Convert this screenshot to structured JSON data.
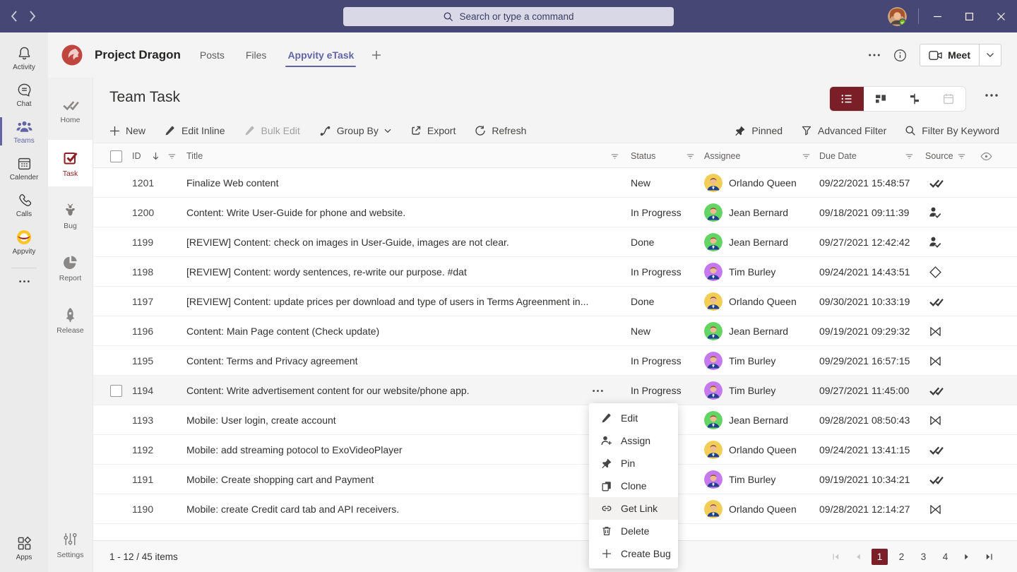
{
  "titlebar": {
    "search_placeholder": "Search or type a command"
  },
  "team_header": {
    "team_name": "Project Dragon",
    "tabs": [
      {
        "label": "Posts"
      },
      {
        "label": "Files"
      },
      {
        "label": "Appvity eTask",
        "active": true
      }
    ],
    "meet_label": "Meet"
  },
  "left_rail": {
    "items": [
      {
        "label": "Activity"
      },
      {
        "label": "Chat"
      },
      {
        "label": "Teams",
        "active": true
      },
      {
        "label": "Calender"
      },
      {
        "label": "Calls"
      },
      {
        "label": "Appvity"
      }
    ],
    "apps_label": "Apps"
  },
  "app_rail": {
    "items": [
      {
        "label": "Home"
      },
      {
        "label": "Task",
        "active": true
      },
      {
        "label": "Bug"
      },
      {
        "label": "Report"
      },
      {
        "label": "Release"
      }
    ],
    "settings_label": "Settings"
  },
  "page": {
    "title": "Team Task"
  },
  "toolbar": {
    "new": "New",
    "edit_inline": "Edit Inline",
    "bulk_edit": "Bulk Edit",
    "bulk_edit_disabled": true,
    "group_by": "Group By",
    "export": "Export",
    "refresh": "Refresh"
  },
  "filter_bar": {
    "pinned": "Pinned",
    "advanced_filter": "Advanced Filter",
    "filter_keyword": "Filter By Keyword"
  },
  "view_switcher": {
    "buttons": [
      {
        "name": "list-view",
        "active": true
      },
      {
        "name": "board-view"
      },
      {
        "name": "gantt-view"
      },
      {
        "name": "calendar-view",
        "disabled": true
      }
    ]
  },
  "table": {
    "columns": {
      "id": "ID",
      "title": "Title",
      "status": "Status",
      "assignee": "Assignee",
      "due": "Due Date",
      "source": "Source"
    },
    "rows": [
      {
        "id": "1201",
        "title": "Finalize Web content",
        "status": "New",
        "assignee": "Orlando Queen",
        "avatar": "yellow",
        "due": "09/22/2021 15:48:57",
        "source": "double-check"
      },
      {
        "id": "1200",
        "title": "Content: Write User-Guide for phone and website.",
        "status": "In Progress",
        "assignee": "Jean Bernard",
        "avatar": "green",
        "due": "09/18/2021 09:11:39",
        "source": "person-check"
      },
      {
        "id": "1199",
        "title": "[REVIEW] Content: check on images in User-Guide, images are not clear.",
        "status": "Done",
        "assignee": "Jean Bernard",
        "avatar": "green",
        "due": "09/27/2021 12:42:42",
        "source": "person-check"
      },
      {
        "id": "1198",
        "title": "[REVIEW] Content: wordy sentences, re-write our purpose. #dat",
        "status": "In Progress",
        "assignee": "Tim Burley",
        "avatar": "purple",
        "due": "09/24/2021 14:43:51",
        "source": "diamond"
      },
      {
        "id": "1197",
        "title": "[REVIEW] Content: update prices per download and type of users in Terms Agreenment in...",
        "status": "Done",
        "assignee": "Orlando Queen",
        "avatar": "yellow",
        "due": "09/30/2021 10:33:19",
        "source": "double-check"
      },
      {
        "id": "1196",
        "title": "Content: Main Page content (Check update)",
        "status": "New",
        "assignee": "Jean Bernard",
        "avatar": "green",
        "due": "09/19/2021 09:29:32",
        "source": "bowtie"
      },
      {
        "id": "1195",
        "title": "Content: Terms and Privacy agreement",
        "status": "In Progress",
        "assignee": "Tim Burley",
        "avatar": "purple",
        "due": "09/29/2021 16:57:15",
        "source": "bowtie"
      },
      {
        "id": "1194",
        "title": "Content: Write advertisement content for our website/phone app.",
        "status": "In Progress",
        "assignee": "Tim Burley",
        "avatar": "purple",
        "due": "09/27/2021 11:45:00",
        "source": "double-check",
        "hover": true
      },
      {
        "id": "1193",
        "title": "Mobile: User login, create account",
        "status": "",
        "assignee": "Jean Bernard",
        "avatar": "green",
        "due": "09/28/2021 08:50:43",
        "source": "bowtie"
      },
      {
        "id": "1192",
        "title": "Mobile: add streaming potocol to ExoVideoPlayer",
        "status": "",
        "assignee": "Orlando Queen",
        "avatar": "yellow",
        "due": "09/24/2021 13:41:15",
        "source": "double-check"
      },
      {
        "id": "1191",
        "title": "Mobile: Create shopping cart and Payment",
        "status": "",
        "assignee": "Tim Burley",
        "avatar": "purple",
        "due": "09/19/2021 10:34:21",
        "source": "double-check"
      },
      {
        "id": "1190",
        "title": "Mobile: create Credit card tab and API receivers.",
        "status": "",
        "assignee": "Orlando Queen",
        "avatar": "yellow",
        "due": "09/28/2021 12:14:27",
        "source": "bowtie"
      }
    ]
  },
  "context_menu": {
    "items": [
      {
        "label": "Edit"
      },
      {
        "label": "Assign"
      },
      {
        "label": "Pin"
      },
      {
        "label": "Clone"
      },
      {
        "label": "Get Link",
        "highlight": true
      },
      {
        "label": "Delete"
      },
      {
        "label": "Create Bug"
      }
    ]
  },
  "footer": {
    "count_text": "1 - 12 / 45 items",
    "pages": [
      {
        "label": "1",
        "active": true
      },
      {
        "label": "2"
      },
      {
        "label": "3"
      },
      {
        "label": "4"
      }
    ]
  },
  "colors": {
    "teams_bar": "#464775",
    "teams_accent": "#6264A7",
    "accent_maroon": "#7A1F28",
    "task_icon_red": "#8B2025",
    "avatar_yellow": "#F3CE56",
    "avatar_green": "#62D562",
    "avatar_purple": "#C678EE",
    "presence_green": "#6BB700"
  }
}
